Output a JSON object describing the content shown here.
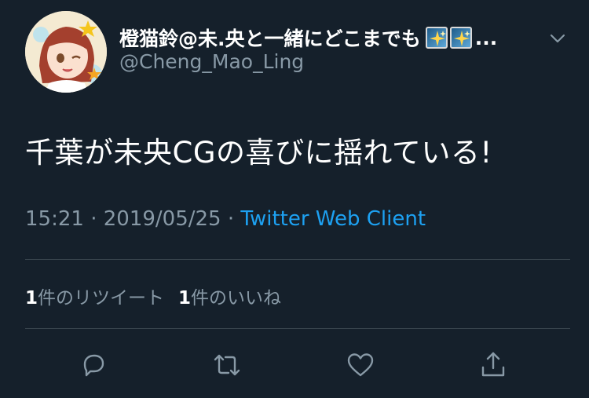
{
  "author": {
    "display_name": "橙猫鈴@未.央と一緒にどこまでも",
    "name_emojis": [
      "sparkles-emoji",
      "sparkles-emoji"
    ],
    "ellipsis": "...",
    "handle": "@Cheng_Mao_Ling",
    "avatar_icon": "anime-avatar"
  },
  "tweet": {
    "text": "千葉が未央CGの喜びに揺れている!",
    "time": "15:21",
    "separator": "·",
    "date": "2019/05/25",
    "source": "Twitter Web Client"
  },
  "stats": {
    "retweets_count": "1",
    "retweets_label": "件のリツイート",
    "likes_count": "1",
    "likes_label": "件のいいね"
  },
  "actions": [
    "reply-icon",
    "retweet-icon",
    "like-icon",
    "share-icon"
  ],
  "colors": {
    "background": "#15202b",
    "text": "#ffffff",
    "secondary": "#8899a6",
    "link": "#1da1f2",
    "divider": "#38444d"
  }
}
